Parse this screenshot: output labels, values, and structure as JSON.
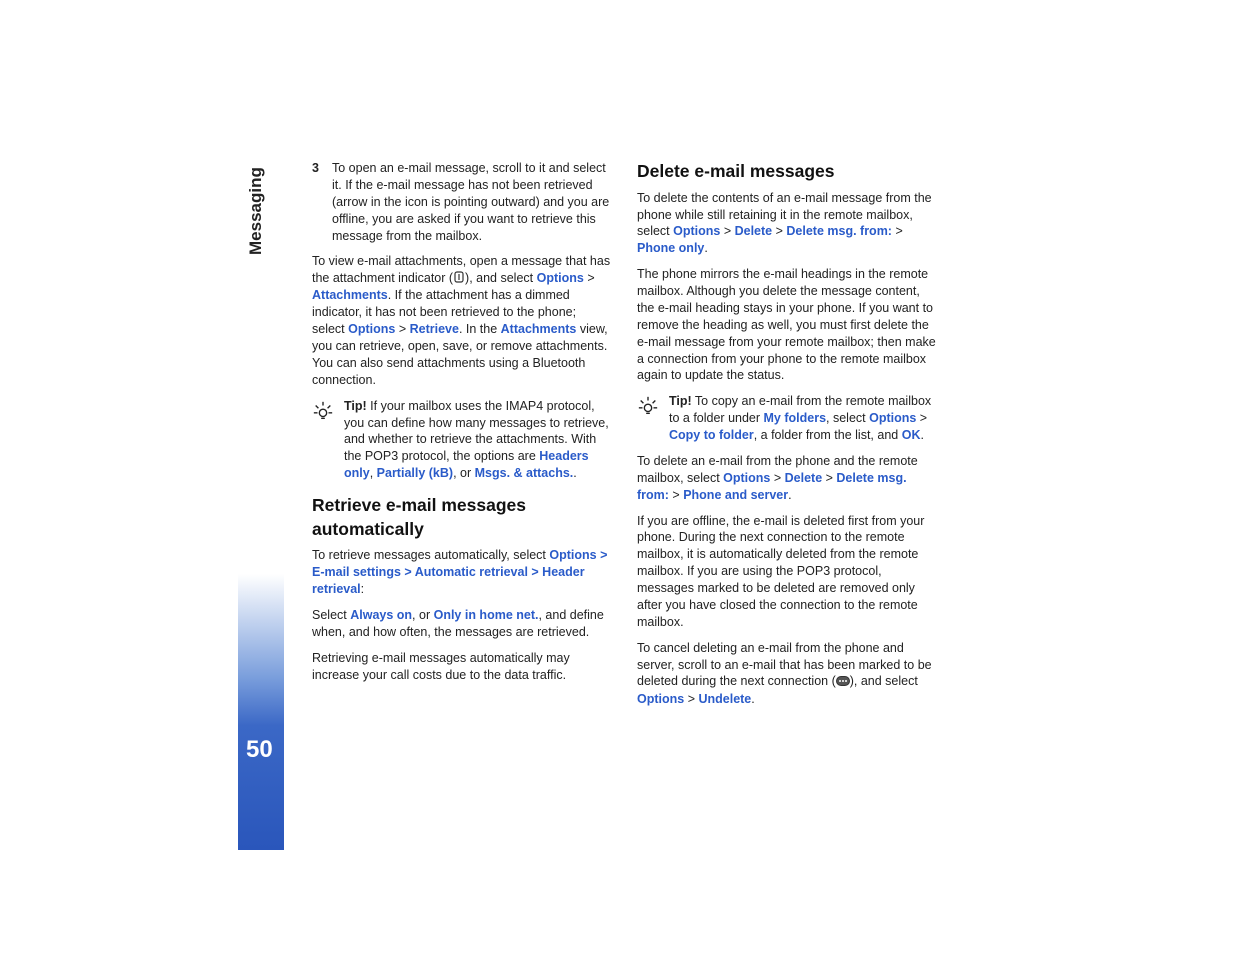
{
  "section_label": "Messaging",
  "page_number": "50",
  "col1": {
    "step3_num": "3",
    "step3_text": "To open an e-mail message, scroll to it and select it. If the e-mail message has not been retrieved (arrow in the icon is pointing outward) and you are offline, you are asked if you want to retrieve this message from the mailbox.",
    "p2_a": "To view e-mail attachments, open a message that has the attachment indicator (",
    "p2_b": "), and select ",
    "p2_options": "Options",
    "p2_gt": " > ",
    "p2_attachments": "Attachments",
    "p2_c": ". If the attachment has a dimmed indicator, it has not been retrieved to the phone; select ",
    "p2_options2": "Options",
    "p2_gt2": " > ",
    "p2_retrieve": "Retrieve",
    "p2_d": ". In the ",
    "p2_attview": "Attachments",
    "p2_e": " view, you can retrieve, open, save, or remove attachments. You can also send attachments using a Bluetooth connection.",
    "tip1_label": "Tip!",
    "tip1_a": " If your mailbox uses the IMAP4 protocol, you can define how many messages to retrieve, and whether to retrieve the attachments. With the POP3 protocol, the options are ",
    "tip1_headers": "Headers only",
    "tip1_c1": ", ",
    "tip1_partially": "Partially (kB)",
    "tip1_c2": ", or ",
    "tip1_msgs": "Msgs. & attachs.",
    "tip1_dot": ".",
    "h_retrieve": "Retrieve e-mail messages automatically",
    "p3_a": "To retrieve messages automatically, select ",
    "p3_path": "Options > E-mail settings > Automatic retrieval > Header retrieval",
    "p3_colon": ":",
    "p4_a": "Select ",
    "p4_always": "Always on",
    "p4_c1": ", or ",
    "p4_homenet": "Only in home net.",
    "p4_b": ", and define when, and how often, the messages are retrieved.",
    "p5": "Retrieving e-mail messages automatically may increase your call costs due to the data traffic."
  },
  "col2": {
    "h_delete": "Delete e-mail messages",
    "p1_a": "To delete the contents of an e-mail message from the phone while still retaining it in the remote mailbox, select ",
    "p1_options": "Options",
    "p1_gt": " > ",
    "p1_delete": "Delete",
    "p1_gt2": " > ",
    "p1_delmsg": "Delete msg. from:",
    "p1_gt3": " > ",
    "p1_phoneonly": "Phone only",
    "p1_dot": ".",
    "p2": "The phone mirrors the e-mail headings in the remote mailbox. Although you delete the message content, the e-mail heading stays in your phone. If you want to remove the heading as well, you must first delete the e-mail message from your remote mailbox; then make a connection from your phone to the remote mailbox again to update the status.",
    "tip2_label": "Tip!",
    "tip2_a": " To copy an e-mail from the remote mailbox to a folder under ",
    "tip2_myfolders": "My folders",
    "tip2_b": ", select ",
    "tip2_options": "Options",
    "tip2_gt": " > ",
    "tip2_copyto": "Copy to folder",
    "tip2_c": ", a folder from the list, and ",
    "tip2_ok": "OK",
    "tip2_dot": ".",
    "p3_a": "To delete an e-mail from the phone and the remote mailbox, select ",
    "p3_options": "Options",
    "p3_gt": " > ",
    "p3_delete": "Delete",
    "p3_gt2": " > ",
    "p3_delmsg": "Delete msg. from:",
    "p3_gt3": " > ",
    "p3_phoneserver": "Phone and server",
    "p3_dot": ".",
    "p4": "If you are offline, the e-mail is deleted first from your phone. During the next connection to the remote mailbox, it is automatically deleted from the remote mailbox. If you are using the POP3 protocol, messages marked to be deleted are removed only after you have closed the connection to the remote mailbox.",
    "p5_a": "To cancel deleting an e-mail from the phone and server, scroll to an e-mail that has been marked to be deleted during the next connection (",
    "p5_b": "), and select ",
    "p5_options": "Options",
    "p5_gt": " > ",
    "p5_undelete": "Undelete",
    "p5_dot": "."
  }
}
